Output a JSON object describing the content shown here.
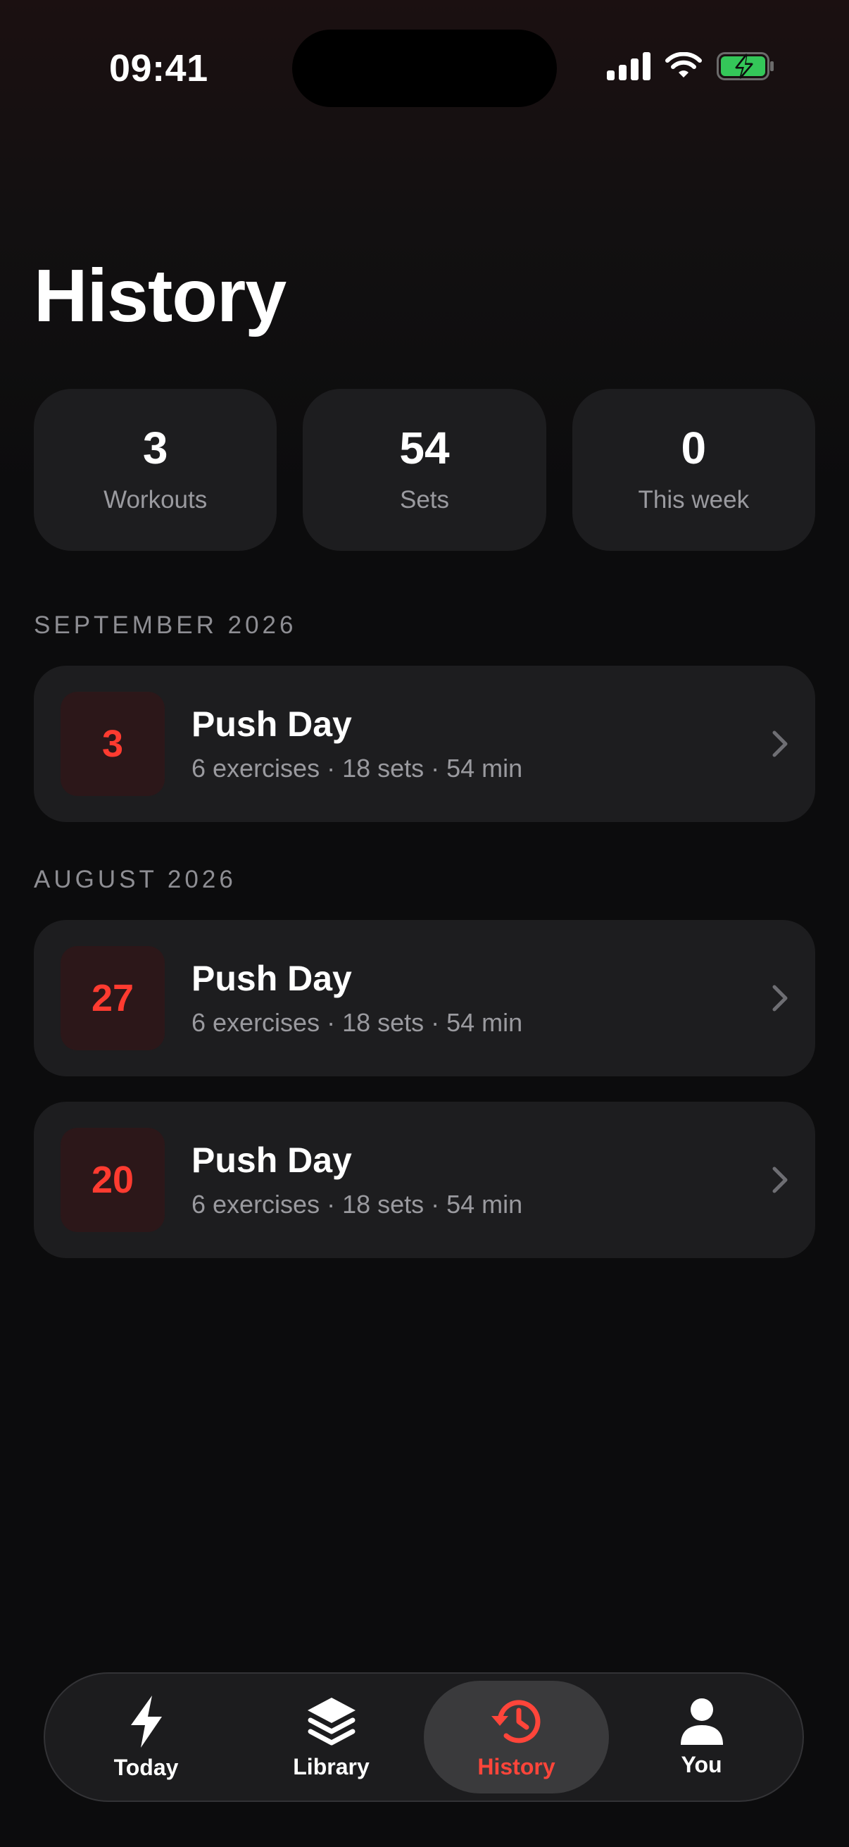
{
  "status_bar": {
    "time": "09:41"
  },
  "header": {
    "title": "History"
  },
  "stats": [
    {
      "value": "3",
      "label": "Workouts"
    },
    {
      "value": "54",
      "label": "Sets"
    },
    {
      "value": "0",
      "label": "This week"
    }
  ],
  "sections": [
    {
      "title": "SEPTEMBER 2026",
      "workouts": [
        {
          "day": "3",
          "name": "Push Day",
          "meta": "6 exercises · 18 sets · 54 min"
        }
      ]
    },
    {
      "title": "AUGUST 2026",
      "workouts": [
        {
          "day": "27",
          "name": "Push Day",
          "meta": "6 exercises · 18 sets · 54 min"
        },
        {
          "day": "20",
          "name": "Push Day",
          "meta": "6 exercises · 18 sets · 54 min"
        }
      ]
    }
  ],
  "tab_bar": {
    "tabs": [
      {
        "label": "Today",
        "icon": "bolt-icon",
        "active": false
      },
      {
        "label": "Library",
        "icon": "layers-icon",
        "active": false
      },
      {
        "label": "History",
        "icon": "history-icon",
        "active": true
      },
      {
        "label": "You",
        "icon": "person-icon",
        "active": false
      }
    ]
  },
  "colors": {
    "accent": "#ff3b30",
    "badge_bg": "#2c1719",
    "card_bg": "#1d1d1f",
    "battery": "#34c759"
  }
}
